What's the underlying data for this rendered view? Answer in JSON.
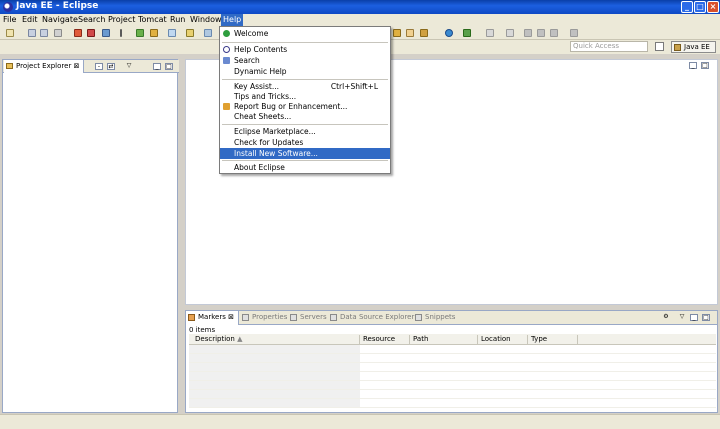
{
  "window": {
    "title": "Java EE - Eclipse"
  },
  "menubar": {
    "items": [
      "File",
      "Edit",
      "Navigate",
      "Search",
      "Project",
      "Tomcat",
      "Run",
      "Window",
      "Help"
    ]
  },
  "toolbar": {
    "quick_access_placeholder": "Quick Access",
    "perspective_label": "Java EE"
  },
  "project_explorer": {
    "tab_label": "Project Explorer"
  },
  "bottom_panel": {
    "tabs": [
      "Markers",
      "Properties",
      "Servers",
      "Data Source Explorer",
      "Snippets"
    ],
    "item_count": "0 items",
    "columns": [
      "Description",
      "Resource",
      "Path",
      "Location",
      "Type"
    ]
  },
  "help_menu": {
    "groups": [
      [
        {
          "label": "Welcome",
          "icon": "welcome-icon"
        }
      ],
      [
        {
          "label": "Help Contents",
          "icon": "help-icon"
        },
        {
          "label": "Search",
          "icon": "search-icon"
        },
        {
          "label": "Dynamic Help",
          "icon": ""
        }
      ],
      [
        {
          "label": "Key Assist...",
          "accel": "Ctrl+Shift+L",
          "icon": ""
        },
        {
          "label": "Tips and Tricks...",
          "icon": ""
        },
        {
          "label": "Report Bug or Enhancement...",
          "icon": "bug-icon"
        },
        {
          "label": "Cheat Sheets...",
          "icon": ""
        }
      ],
      [
        {
          "label": "Eclipse Marketplace...",
          "icon": ""
        },
        {
          "label": "Check for Updates",
          "icon": ""
        },
        {
          "label": "Install New Software...",
          "icon": "",
          "selected": true
        }
      ],
      [
        {
          "label": "About Eclipse",
          "icon": ""
        }
      ]
    ]
  },
  "colors": {
    "selection": "#316ac5",
    "titlebar": "#1c5fe0"
  }
}
